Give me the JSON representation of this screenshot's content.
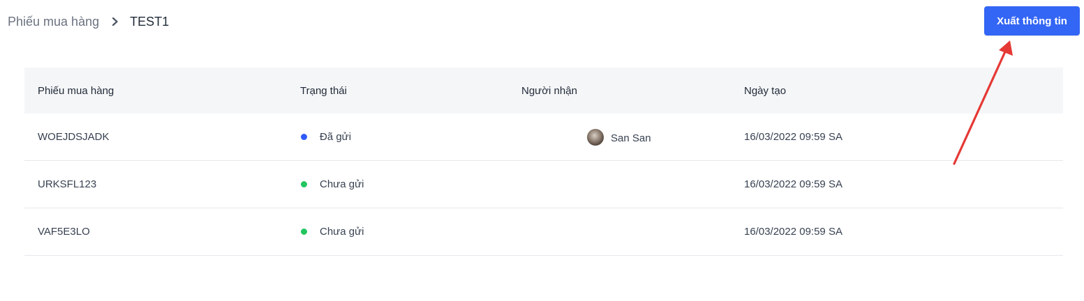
{
  "breadcrumb": {
    "parent": "Phiếu mua hàng",
    "current": "TEST1"
  },
  "toolbar": {
    "export_label": "Xuất thông tin"
  },
  "table": {
    "columns": [
      "Phiếu mua hàng",
      "Trạng thái",
      "Người nhận",
      "Ngày tạo"
    ],
    "rows": [
      {
        "code": "WOEJDSJADK",
        "status": "Đã gửi",
        "status_color": "#2e5bff",
        "recipient": "San San",
        "created": "16/03/2022 09:59 SA"
      },
      {
        "code": "URKSFL123",
        "status": "Chưa gửi",
        "status_color": "#22c55e",
        "recipient": "",
        "created": "16/03/2022 09:59 SA"
      },
      {
        "code": "VAF5E3LO",
        "status": "Chưa gửi",
        "status_color": "#22c55e",
        "recipient": "",
        "created": "16/03/2022 09:59 SA"
      }
    ]
  },
  "colors": {
    "accent": "#3366f5",
    "annotation_arrow": "#e53935",
    "sent_dot": "#2e5bff",
    "unsent_dot": "#22c55e"
  },
  "icons": {
    "breadcrumb_separator": "chevron-right-icon",
    "annotation": "red-arrow-pointer"
  }
}
